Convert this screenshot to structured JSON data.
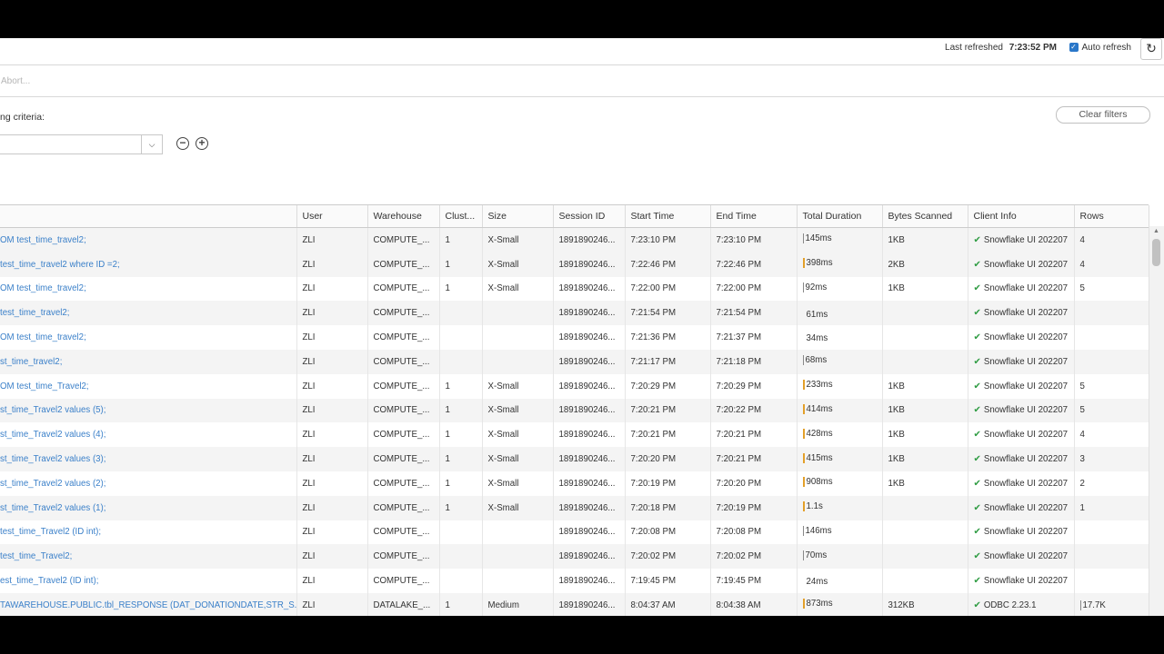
{
  "header": {
    "last_refreshed_label": "Last refreshed",
    "last_refreshed_time": "7:23:52 PM",
    "auto_refresh_label": "Auto refresh"
  },
  "search": {
    "placeholder": "Abort..."
  },
  "filters": {
    "label": "ng criteria:",
    "clear_label": "Clear filters"
  },
  "table": {
    "columns": [
      "",
      "User",
      "Warehouse",
      "Clust...",
      "Size",
      "Session ID",
      "Start Time",
      "End Time",
      "Total Duration",
      "Bytes Scanned",
      "Client Info",
      "Rows"
    ],
    "rows": [
      {
        "sql": "OM test_time_travel2;",
        "user": "ZLI",
        "warehouse": "COMPUTE_...",
        "cluster": "1",
        "size": "X-Small",
        "session": "1891890246...",
        "start": "7:23:10 PM",
        "end": "7:23:10 PM",
        "duration": "145ms",
        "bar": "thin",
        "bytes": "1KB",
        "client": "Snowflake UI 202207",
        "rows": "4"
      },
      {
        "sql": "test_time_travel2 where ID =2;",
        "user": "ZLI",
        "warehouse": "COMPUTE_...",
        "cluster": "1",
        "size": "X-Small",
        "session": "1891890246...",
        "start": "7:22:46 PM",
        "end": "7:22:46 PM",
        "duration": "398ms",
        "bar": "orange",
        "bytes": "2KB",
        "client": "Snowflake UI 202207",
        "rows": "4"
      },
      {
        "sql": "OM test_time_travel2;",
        "user": "ZLI",
        "warehouse": "COMPUTE_...",
        "cluster": "1",
        "size": "X-Small",
        "session": "1891890246...",
        "start": "7:22:00 PM",
        "end": "7:22:00 PM",
        "duration": "92ms",
        "bar": "thin",
        "bytes": "1KB",
        "client": "Snowflake UI 202207",
        "rows": "5"
      },
      {
        "sql": "test_time_travel2;",
        "user": "ZLI",
        "warehouse": "COMPUTE_...",
        "cluster": "",
        "size": "",
        "session": "1891890246...",
        "start": "7:21:54 PM",
        "end": "7:21:54 PM",
        "duration": "61ms",
        "bar": "none",
        "bytes": "",
        "client": "Snowflake UI 202207",
        "rows": ""
      },
      {
        "sql": "OM test_time_travel2;",
        "user": "ZLI",
        "warehouse": "COMPUTE_...",
        "cluster": "",
        "size": "",
        "session": "1891890246...",
        "start": "7:21:36 PM",
        "end": "7:21:37 PM",
        "duration": "34ms",
        "bar": "none",
        "bytes": "",
        "client": "Snowflake UI 202207",
        "rows": ""
      },
      {
        "sql": "st_time_travel2;",
        "user": "ZLI",
        "warehouse": "COMPUTE_...",
        "cluster": "",
        "size": "",
        "session": "1891890246...",
        "start": "7:21:17 PM",
        "end": "7:21:18 PM",
        "duration": "68ms",
        "bar": "thin",
        "bytes": "",
        "client": "Snowflake UI 202207",
        "rows": ""
      },
      {
        "sql": "OM test_time_Travel2;",
        "user": "ZLI",
        "warehouse": "COMPUTE_...",
        "cluster": "1",
        "size": "X-Small",
        "session": "1891890246...",
        "start": "7:20:29 PM",
        "end": "7:20:29 PM",
        "duration": "233ms",
        "bar": "orange",
        "bytes": "1KB",
        "client": "Snowflake UI 202207",
        "rows": "5"
      },
      {
        "sql": "st_time_Travel2 values (5);",
        "user": "ZLI",
        "warehouse": "COMPUTE_...",
        "cluster": "1",
        "size": "X-Small",
        "session": "1891890246...",
        "start": "7:20:21 PM",
        "end": "7:20:22 PM",
        "duration": "414ms",
        "bar": "orange",
        "bytes": "1KB",
        "client": "Snowflake UI 202207",
        "rows": "5"
      },
      {
        "sql": "st_time_Travel2 values (4);",
        "user": "ZLI",
        "warehouse": "COMPUTE_...",
        "cluster": "1",
        "size": "X-Small",
        "session": "1891890246...",
        "start": "7:20:21 PM",
        "end": "7:20:21 PM",
        "duration": "428ms",
        "bar": "orange",
        "bytes": "1KB",
        "client": "Snowflake UI 202207",
        "rows": "4"
      },
      {
        "sql": "st_time_Travel2 values (3);",
        "user": "ZLI",
        "warehouse": "COMPUTE_...",
        "cluster": "1",
        "size": "X-Small",
        "session": "1891890246...",
        "start": "7:20:20 PM",
        "end": "7:20:21 PM",
        "duration": "415ms",
        "bar": "orange",
        "bytes": "1KB",
        "client": "Snowflake UI 202207",
        "rows": "3"
      },
      {
        "sql": "st_time_Travel2 values (2);",
        "user": "ZLI",
        "warehouse": "COMPUTE_...",
        "cluster": "1",
        "size": "X-Small",
        "session": "1891890246...",
        "start": "7:20:19 PM",
        "end": "7:20:20 PM",
        "duration": "908ms",
        "bar": "orange",
        "bytes": "1KB",
        "client": "Snowflake UI 202207",
        "rows": "2"
      },
      {
        "sql": "st_time_Travel2 values (1);",
        "user": "ZLI",
        "warehouse": "COMPUTE_...",
        "cluster": "1",
        "size": "X-Small",
        "session": "1891890246...",
        "start": "7:20:18 PM",
        "end": "7:20:19 PM",
        "duration": "1.1s",
        "bar": "orange",
        "bytes": "",
        "client": "Snowflake UI 202207",
        "rows": "1"
      },
      {
        "sql": "test_time_Travel2 (ID int);",
        "user": "ZLI",
        "warehouse": "COMPUTE_...",
        "cluster": "",
        "size": "",
        "session": "1891890246...",
        "start": "7:20:08 PM",
        "end": "7:20:08 PM",
        "duration": "146ms",
        "bar": "thin",
        "bytes": "",
        "client": "Snowflake UI 202207",
        "rows": ""
      },
      {
        "sql": "test_time_Travel2;",
        "user": "ZLI",
        "warehouse": "COMPUTE_...",
        "cluster": "",
        "size": "",
        "session": "1891890246...",
        "start": "7:20:02 PM",
        "end": "7:20:02 PM",
        "duration": "70ms",
        "bar": "thin",
        "bytes": "",
        "client": "Snowflake UI 202207",
        "rows": ""
      },
      {
        "sql": "est_time_Travel2 (ID int);",
        "user": "ZLI",
        "warehouse": "COMPUTE_...",
        "cluster": "",
        "size": "",
        "session": "1891890246...",
        "start": "7:19:45 PM",
        "end": "7:19:45 PM",
        "duration": "24ms",
        "bar": "none",
        "bytes": "",
        "client": "Snowflake UI 202207",
        "rows": ""
      },
      {
        "sql": "TAWAREHOUSE.PUBLIC.tbl_RESPONSE (DAT_DONATIONDATE,STR_S...",
        "user": "ZLI",
        "warehouse": "DATALAKE_...",
        "cluster": "1",
        "size": "Medium",
        "session": "1891890246...",
        "start": "8:04:37 AM",
        "end": "8:04:38 AM",
        "duration": "873ms",
        "bar": "orange",
        "bytes": "312KB",
        "client": "ODBC 2.23.1",
        "rows": "17.7K"
      }
    ]
  },
  "colors": {
    "link": "#3b80c9",
    "status_ok": "#2f9c43",
    "duration_bar": "#e3a02a"
  },
  "icons": {
    "refresh": "refresh-icon",
    "check": "checkmark-icon",
    "dropdown": "chevron-down-icon",
    "remove": "minus-circle-icon",
    "add": "plus-circle-icon"
  }
}
